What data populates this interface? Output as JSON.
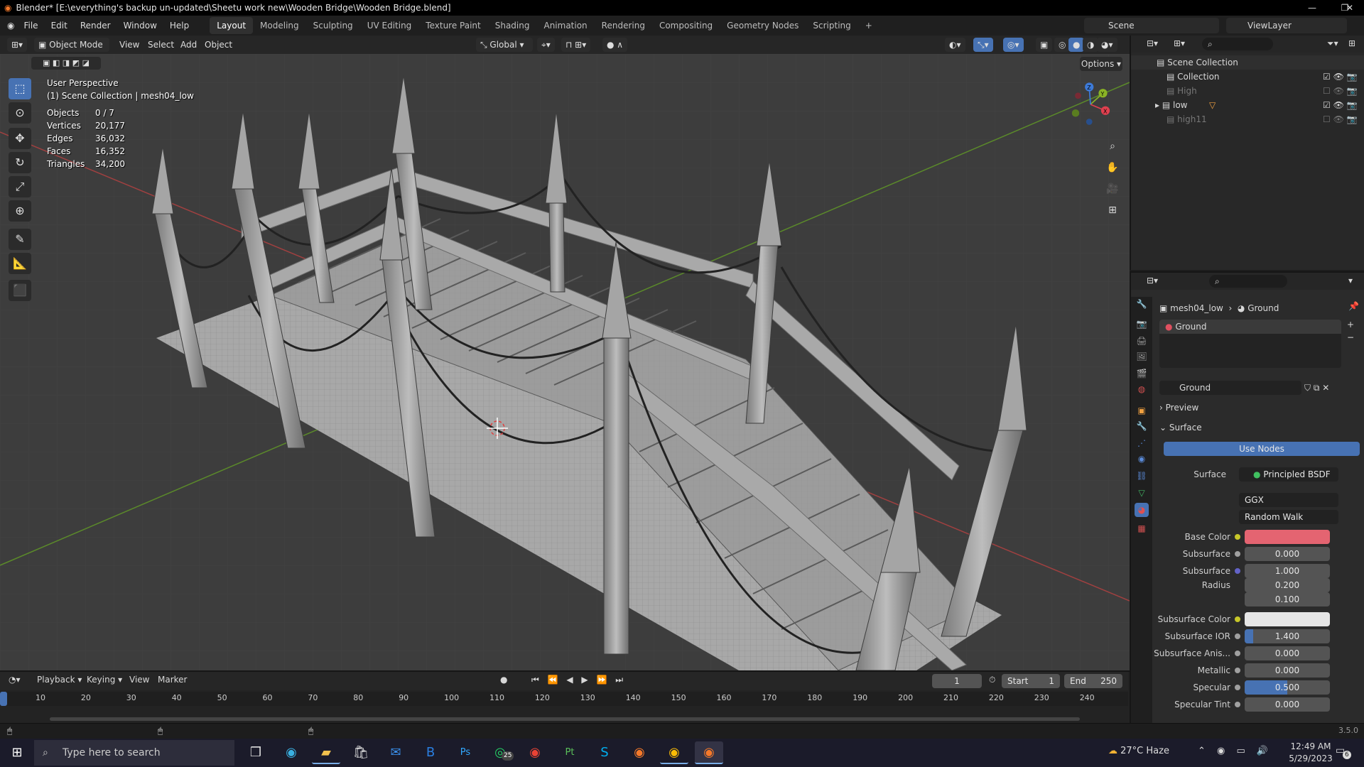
{
  "title_bar": {
    "text": "Blender* [E:\\everything's backup un-updated\\Sheetu work new\\Wooden Bridge\\Wooden Bridge.blend]"
  },
  "menu": [
    "File",
    "Edit",
    "Render",
    "Window",
    "Help"
  ],
  "workspaces": [
    "Layout",
    "Modeling",
    "Sculpting",
    "UV Editing",
    "Texture Paint",
    "Shading",
    "Animation",
    "Rendering",
    "Compositing",
    "Geometry Nodes",
    "Scripting"
  ],
  "active_workspace": "Layout",
  "scene_name": "Scene",
  "view_layer": "ViewLayer",
  "viewport_header": {
    "mode": "Object Mode",
    "view": "View",
    "select": "Select",
    "add": "Add",
    "object": "Object",
    "orientation": "Global",
    "options": "Options"
  },
  "viewport_info": {
    "perspective": "User Perspective",
    "collection": "(1) Scene Collection | mesh04_low"
  },
  "stats": [
    {
      "label": "Objects",
      "value": "0 / 7"
    },
    {
      "label": "Vertices",
      "value": "20,177"
    },
    {
      "label": "Edges",
      "value": "36,032"
    },
    {
      "label": "Faces",
      "value": "16,352"
    },
    {
      "label": "Triangles",
      "value": "34,200"
    }
  ],
  "gizmo": {
    "x": "X",
    "y": "Y",
    "z": "Z"
  },
  "outliner": {
    "root": "Scene Collection",
    "items": [
      "Collection",
      "High",
      "low",
      "high11"
    ]
  },
  "properties": {
    "breadcrumb_object": "mesh04_low",
    "breadcrumb_material": "Ground",
    "slot_name": "Ground",
    "material_name": "Ground",
    "preview_label": "Preview",
    "surface_label": "Surface",
    "use_nodes": "Use Nodes",
    "surface_field_label": "Surface",
    "surface_shader": "Principled BSDF",
    "distribution": "GGX",
    "subsurface_method": "Random Walk",
    "fields": [
      {
        "label": "Base Color",
        "value": ""
      },
      {
        "label": "Subsurface",
        "value": "0.000"
      },
      {
        "label": "Subsurface Radius",
        "value": "1.000"
      },
      {
        "label": "",
        "value": "0.200"
      },
      {
        "label": "",
        "value": "0.100"
      },
      {
        "label": "Subsurface Color",
        "value": ""
      },
      {
        "label": "Subsurface IOR",
        "value": "1.400"
      },
      {
        "label": "Subsurface Anis...",
        "value": "0.000"
      },
      {
        "label": "Metallic",
        "value": "0.000"
      },
      {
        "label": "Specular",
        "value": "0.500"
      },
      {
        "label": "Specular Tint",
        "value": "0.000"
      }
    ],
    "base_color": "#e46471",
    "subsurface_color": "#e6e6e6",
    "subsurface_ior_fill": 0.1,
    "specular_fill": 0.5
  },
  "timeline": {
    "playback": "Playback",
    "keying": "Keying",
    "view": "View",
    "marker": "Marker",
    "current_frame": "1",
    "start_label": "Start",
    "start": "1",
    "end_label": "End",
    "end": "250",
    "ruler": [
      "10",
      "20",
      "30",
      "40",
      "50",
      "60",
      "70",
      "80",
      "90",
      "100",
      "110",
      "120",
      "130",
      "140",
      "150",
      "160",
      "170",
      "180",
      "190",
      "200",
      "210",
      "220",
      "230",
      "240"
    ]
  },
  "status": {
    "version": "3.5.0"
  },
  "taskbar": {
    "search_placeholder": "Type here to search",
    "whatsapp_badge": "25",
    "weather": "27°C  Haze",
    "time": "12:49 AM",
    "date": "5/29/2023",
    "notifications": "6"
  }
}
